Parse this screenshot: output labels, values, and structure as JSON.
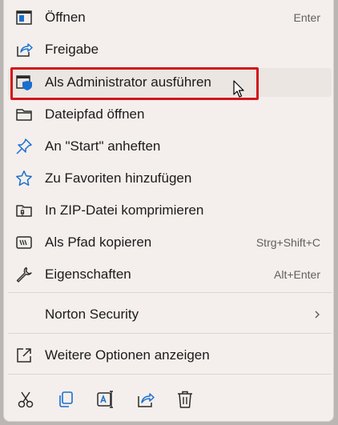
{
  "menu": {
    "items": [
      {
        "label": "Öffnen",
        "shortcut": "Enter",
        "icon": "open-window-icon"
      },
      {
        "label": "Freigabe",
        "shortcut": "",
        "icon": "share-icon"
      },
      {
        "label": "Als Administrator ausführen",
        "shortcut": "",
        "icon": "shield-window-icon"
      },
      {
        "label": "Dateipfad öffnen",
        "shortcut": "",
        "icon": "folder-icon"
      },
      {
        "label": "An \"Start\" anheften",
        "shortcut": "",
        "icon": "pin-icon"
      },
      {
        "label": "Zu Favoriten hinzufügen",
        "shortcut": "",
        "icon": "star-icon"
      },
      {
        "label": "In ZIP-Datei komprimieren",
        "shortcut": "",
        "icon": "zip-folder-icon"
      },
      {
        "label": "Als Pfad kopieren",
        "shortcut": "Strg+Shift+C",
        "icon": "copy-path-icon"
      },
      {
        "label": "Eigenschaften",
        "shortcut": "Alt+Enter",
        "icon": "wrench-icon"
      },
      {
        "label": "Norton Security",
        "shortcut": "",
        "icon": "chevron-right-icon"
      },
      {
        "label": "Weitere Optionen anzeigen",
        "shortcut": "",
        "icon": "external-link-icon"
      }
    ]
  },
  "toolbar": {
    "buttons": [
      {
        "icon": "cut-icon"
      },
      {
        "icon": "copy-icon"
      },
      {
        "icon": "rename-icon"
      },
      {
        "icon": "share-icon"
      },
      {
        "icon": "delete-icon"
      }
    ]
  },
  "colors": {
    "accent": "#1a6fd0",
    "highlight_border": "#d4151a",
    "menu_bg": "#f4efec",
    "hover_bg": "#ebe6e2"
  }
}
